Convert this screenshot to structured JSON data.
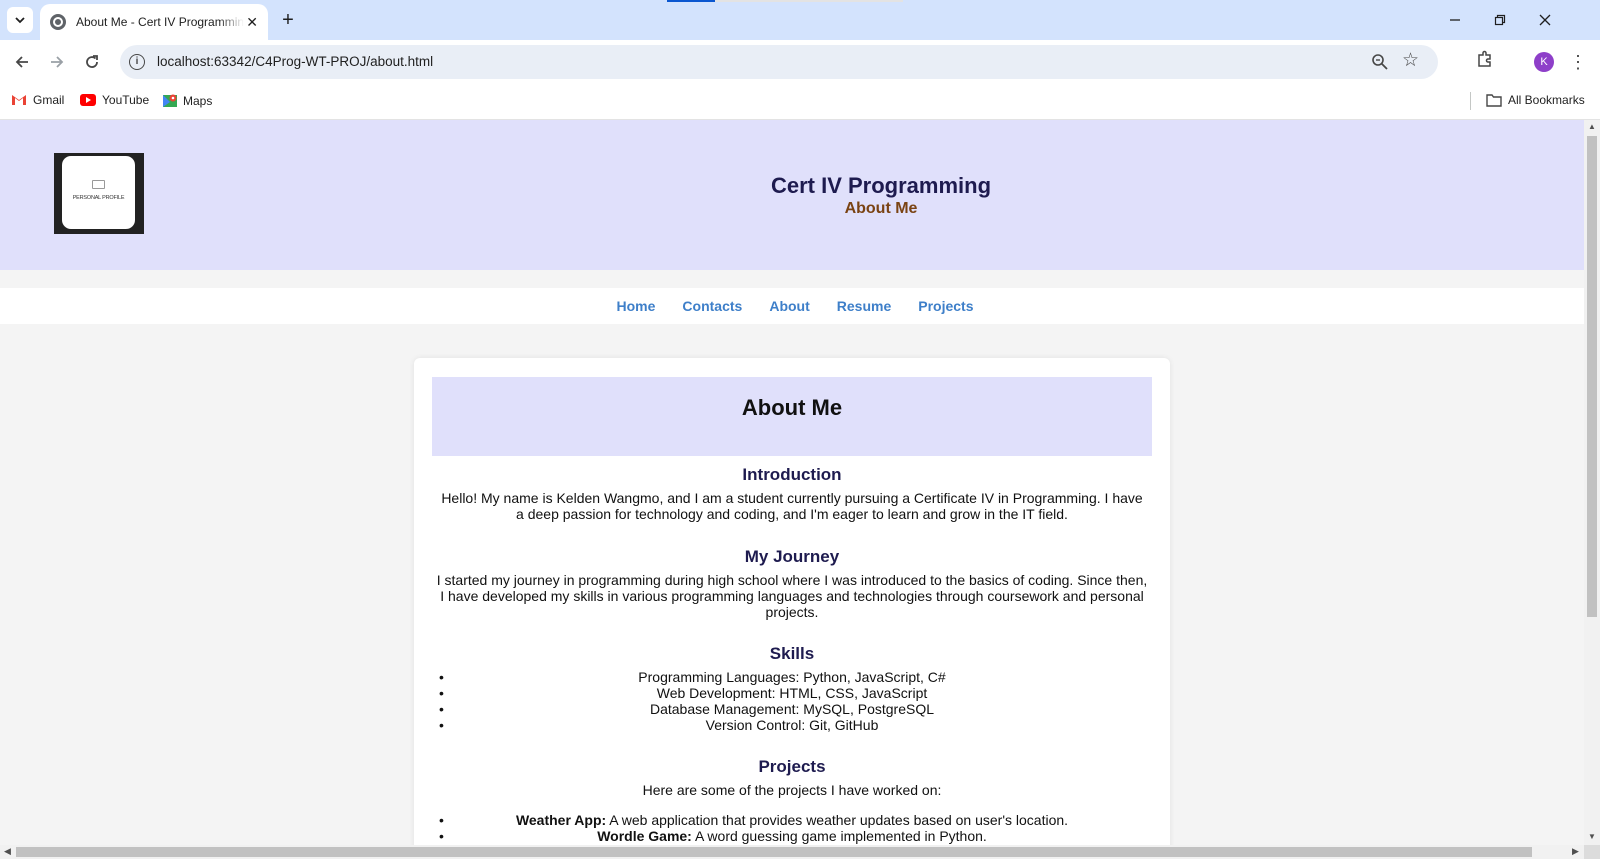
{
  "browser": {
    "tab_title": "About Me - Cert IV Programming",
    "url": "localhost:63342/C4Prog-WT-PROJ/about.html",
    "profile_initial": "K",
    "bookmarks": [
      "Gmail",
      "YouTube",
      "Maps"
    ],
    "all_bookmarks": "All Bookmarks",
    "icons": [
      "tab-search-icon",
      "close-icon",
      "new-tab-icon",
      "minimize-icon",
      "restore-icon",
      "back-icon",
      "forward-icon",
      "reload-icon",
      "site-info-icon",
      "zoom-icon",
      "bookmark-star-icon",
      "extensions-icon",
      "menu-icon",
      "folder-icon"
    ]
  },
  "header": {
    "logo_text": "PERSONAL PROFILE",
    "title": "Cert IV Programming",
    "subtitle": "About Me"
  },
  "nav": {
    "items": [
      "Home",
      "Contacts",
      "About",
      "Resume",
      "Projects"
    ]
  },
  "content": {
    "title": "About Me",
    "intro": {
      "heading": "Introduction",
      "text": "Hello! My name is Kelden Wangmo, and I am a student currently pursuing a Certificate IV in Programming. I have a deep passion for technology and coding, and I'm eager to learn and grow in the IT field."
    },
    "journey": {
      "heading": "My Journey",
      "text": "I started my journey in programming during high school where I was introduced to the basics of coding. Since then, I have developed my skills in various programming languages and technologies through coursework and personal projects."
    },
    "skills": {
      "heading": "Skills",
      "items": [
        "Programming Languages: Python, JavaScript, C#",
        "Web Development: HTML, CSS, JavaScript",
        "Database Management: MySQL, PostgreSQL",
        "Version Control: Git, GitHub"
      ]
    },
    "projects": {
      "heading": "Projects",
      "intro": "Here are some of the projects I have worked on:",
      "items": [
        {
          "name": "Weather App:",
          "desc": " A web application that provides weather updates based on user's location."
        },
        {
          "name": "Wordle Game:",
          "desc": " A word guessing game implemented in Python."
        }
      ]
    }
  },
  "colors": {
    "header_bg": "#e0e0fb",
    "title": "#1e1b4f",
    "subtitle": "#7a4313",
    "nav_link": "#3e7fc9",
    "page_bg": "#f4f4f4"
  }
}
